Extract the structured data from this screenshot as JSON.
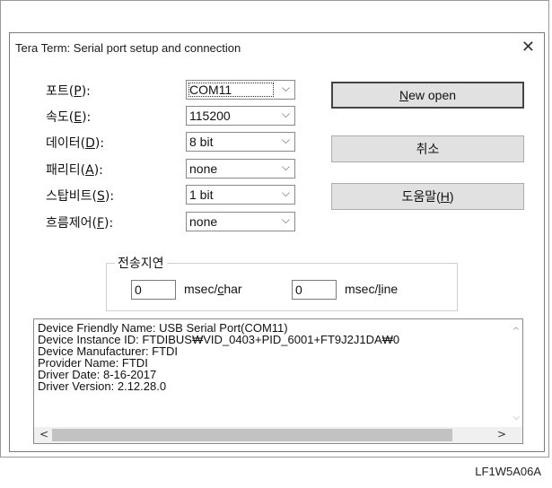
{
  "window": {
    "title": "Tera Term: Serial port setup and connection",
    "close_glyph": "✕"
  },
  "fields": [
    {
      "label": "포트(P):",
      "value": "COM11"
    },
    {
      "label": "속도(E):",
      "value": "115200"
    },
    {
      "label": "데이터(D):",
      "value": "8 bit"
    },
    {
      "label": "패리티(A):",
      "value": "none"
    },
    {
      "label": "스탑비트(S):",
      "value": "1 bit"
    },
    {
      "label": "흐름제어(F):",
      "value": "none"
    }
  ],
  "buttons": {
    "new_open": "New open",
    "cancel": "취소",
    "help": "도움말(H)"
  },
  "transmit_delay": {
    "title": "전송지연",
    "char_value": "0",
    "char_unit": "msec/char",
    "line_value": "0",
    "line_unit": "msec/line"
  },
  "device_info": [
    "Device Friendly Name: USB Serial Port(COM11)",
    "Device Instance ID: FTDIBUS₩VID_0403+PID_6001+FT9J2J1DA₩0",
    "Device Manufacturer: FTDI",
    "Provider Name: FTDI",
    "Driver Date: 8-16-2017",
    "Driver Version: 2.12.28.0"
  ],
  "icons": {
    "chevron": "⌵",
    "scroll_up": "^",
    "scroll_down": "⌵",
    "scroll_left": "<",
    "scroll_right": ">"
  },
  "caption": "LF1W5A06A"
}
